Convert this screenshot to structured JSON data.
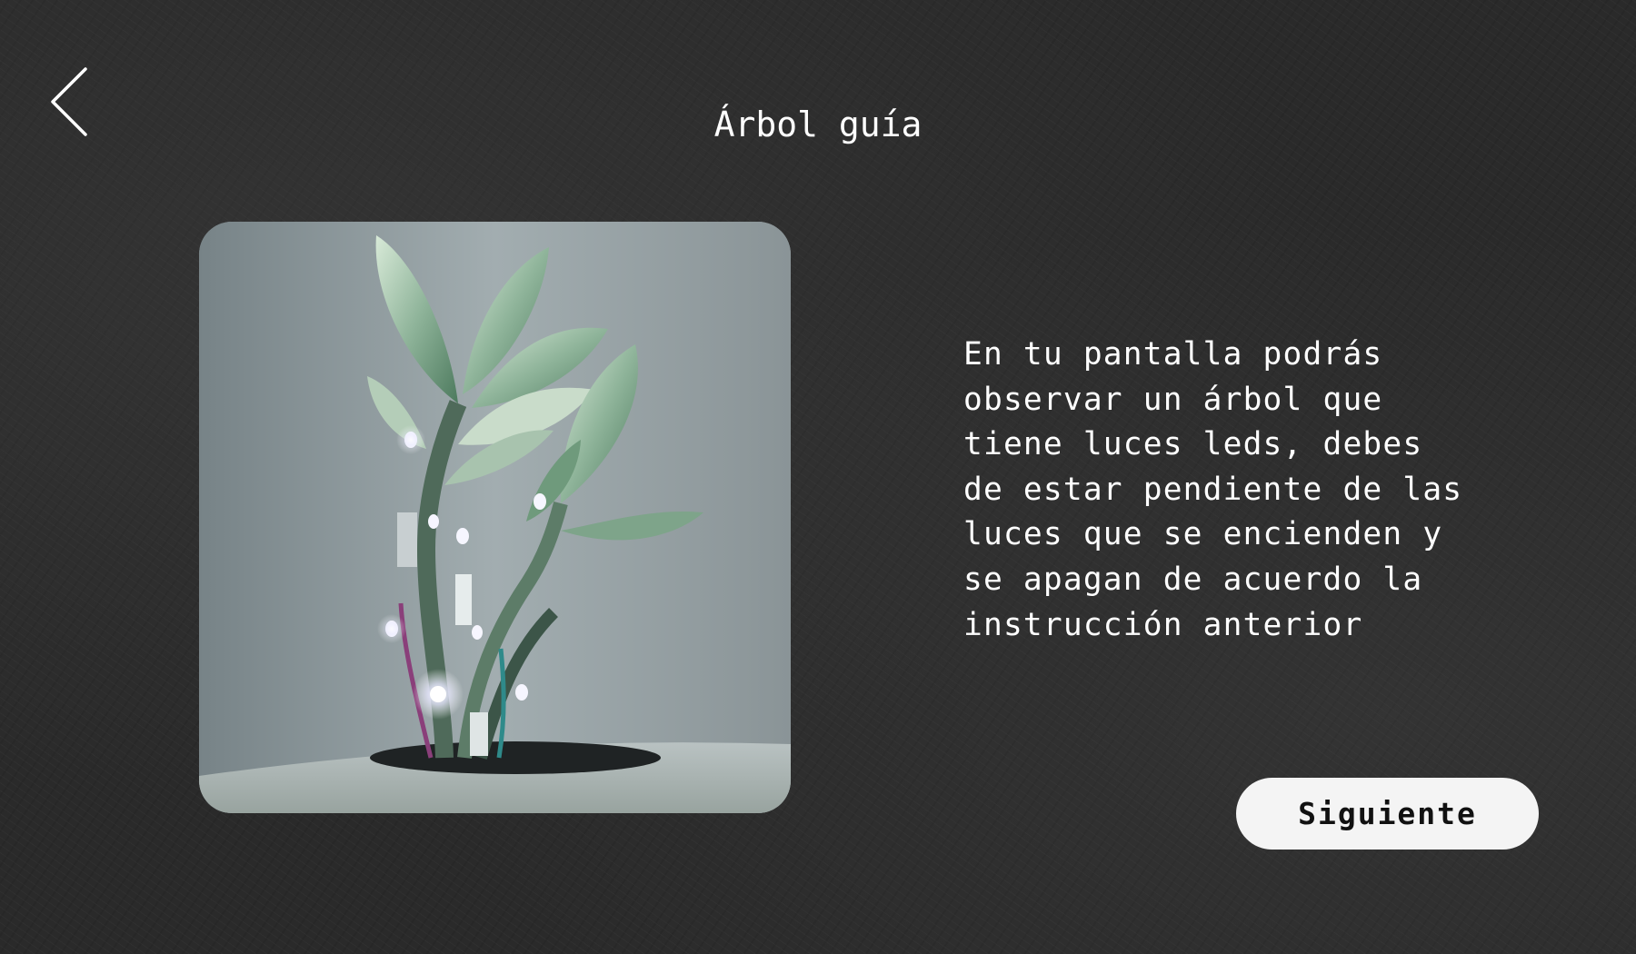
{
  "header": {
    "back_icon": "chevron-left-icon",
    "title": "Árbol guía"
  },
  "main": {
    "image_subject": "plant-with-led-lights",
    "description_lines": [
      "En tu pantalla podrás",
      "observar un árbol que",
      "tiene luces leds, debes",
      "de estar pendiente de las",
      "luces que se encienden y",
      "se apagan de acuerdo la",
      "instrucción anterior"
    ]
  },
  "footer": {
    "next_label": "Siguiente"
  },
  "colors": {
    "background": "#2a2a2a",
    "text": "#ffffff",
    "button_background": "#f4f4f4",
    "button_text": "#111111"
  }
}
